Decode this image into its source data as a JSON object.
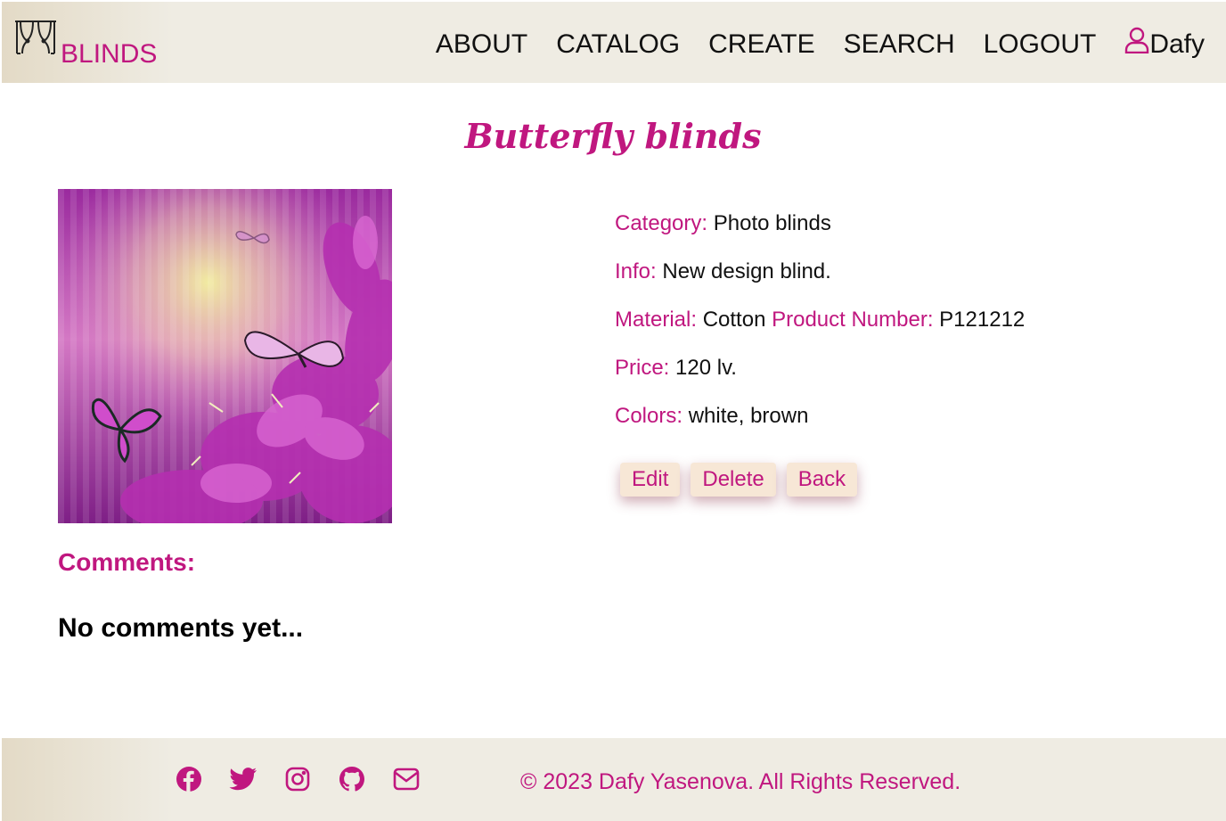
{
  "colors": {
    "accent": "#c0177f",
    "header_bg": "#efece3",
    "button_bg": "#f7e7d6"
  },
  "header": {
    "logo_text": "BLINDS",
    "logo_icon": "curtains-icon",
    "nav": [
      {
        "label": "ABOUT"
      },
      {
        "label": "CATALOG"
      },
      {
        "label": "CREATE"
      },
      {
        "label": "SEARCH"
      },
      {
        "label": "LOGOUT"
      }
    ],
    "user": {
      "icon": "user-icon",
      "name": "Dafy"
    }
  },
  "product": {
    "title": "Butterfly blinds",
    "image_subject": "purple butterflies and flowers",
    "category": {
      "label": "Category:",
      "value": "Photo blinds"
    },
    "info": {
      "label": "Info:",
      "value": "New design blind."
    },
    "material": {
      "label": "Material:",
      "value": "Cotton"
    },
    "product_number": {
      "label": "Product Number:",
      "value": "P121212"
    },
    "price": {
      "label": "Price:",
      "value": "120 lv."
    },
    "colors": {
      "label": "Colors:",
      "value": "white, brown"
    }
  },
  "actions": {
    "edit": "Edit",
    "delete": "Delete",
    "back": "Back"
  },
  "comments": {
    "title": "Comments:",
    "empty": "No comments yet..."
  },
  "footer": {
    "social": [
      "facebook-icon",
      "twitter-icon",
      "instagram-icon",
      "github-icon",
      "envelope-icon"
    ],
    "copyright": "© 2023 Dafy Yasenova. All Rights Reserved."
  }
}
